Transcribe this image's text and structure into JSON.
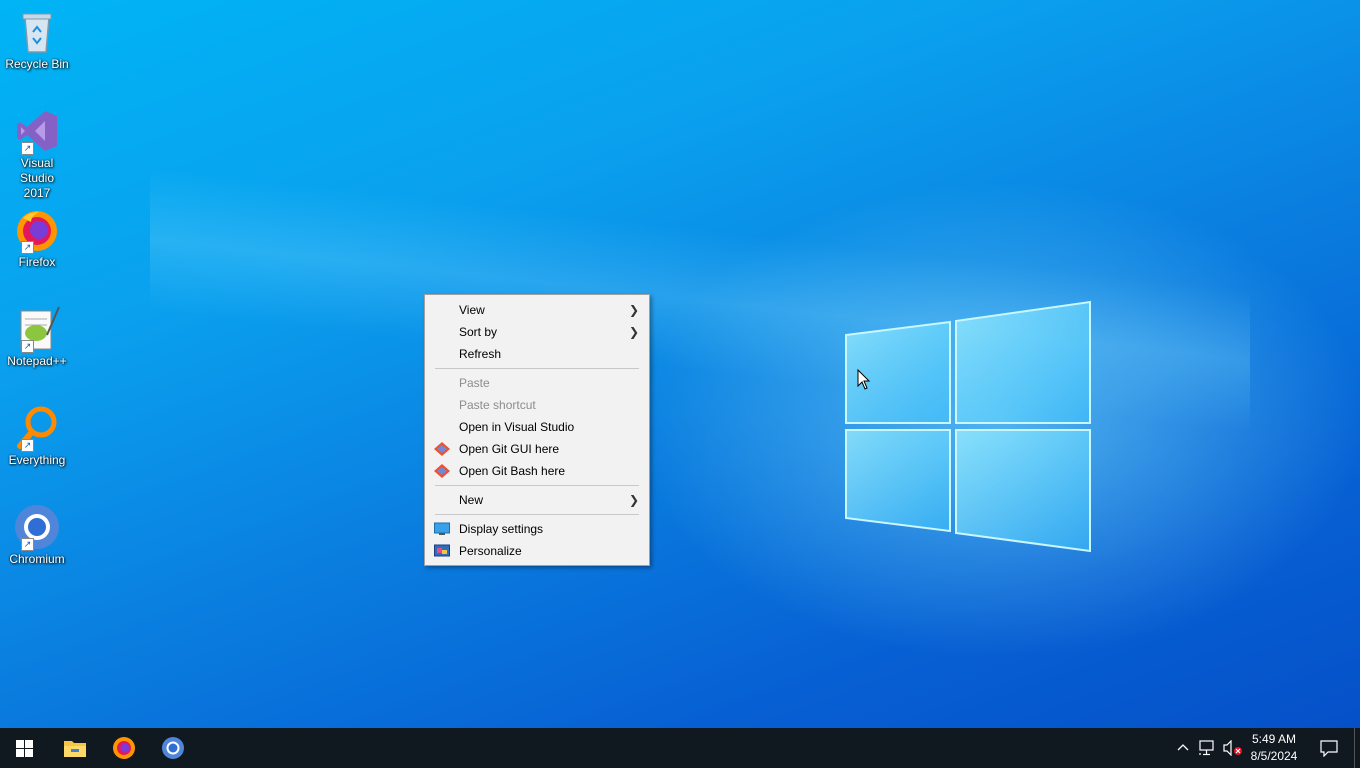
{
  "desktop": {
    "icons": [
      {
        "label": "Recycle Bin"
      },
      {
        "label": "Visual Studio\n2017"
      },
      {
        "label": "Firefox"
      },
      {
        "label": "Notepad++"
      },
      {
        "label": "Everything"
      },
      {
        "label": "Chromium"
      }
    ]
  },
  "context_menu": {
    "view": "View",
    "sort_by": "Sort by",
    "refresh": "Refresh",
    "paste": "Paste",
    "paste_shortcut": "Paste shortcut",
    "open_vs": "Open in Visual Studio",
    "git_gui": "Open Git GUI here",
    "git_bash": "Open Git Bash here",
    "new": "New",
    "display_settings": "Display settings",
    "personalize": "Personalize"
  },
  "taskbar": {
    "pinned": [
      "start-icon",
      "file-explorer-icon",
      "firefox-icon",
      "chromium-icon"
    ],
    "clock": {
      "time": "5:49 AM",
      "date": "8/5/2024"
    }
  },
  "colors": {
    "desktop_accent": "#0a7fe0",
    "taskbar": "#101820",
    "menu_bg": "#f2f2f2"
  }
}
